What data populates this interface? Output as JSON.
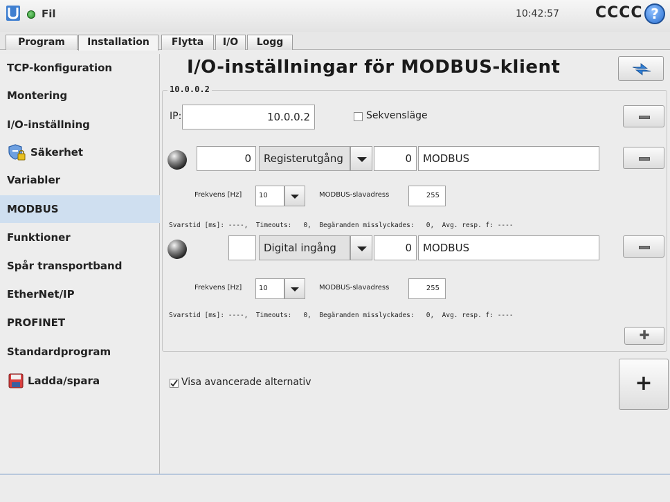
{
  "header": {
    "file_label": "Fil",
    "clock": "10:42:57",
    "robot_name": "CCCC",
    "help_icon": "?"
  },
  "tabs": [
    {
      "label": "Program",
      "active": false
    },
    {
      "label": "Installation",
      "active": true
    },
    {
      "label": "Flytta",
      "active": false
    },
    {
      "label": "I/O",
      "active": false
    },
    {
      "label": "Logg",
      "active": false
    }
  ],
  "sidebar": {
    "items": [
      {
        "label": "TCP-konfiguration"
      },
      {
        "label": "Montering"
      },
      {
        "label": "I/O-inställning"
      },
      {
        "label": "Säkerhet",
        "icon": "shield-lock-icon"
      },
      {
        "label": "Variabler"
      },
      {
        "label": "MODBUS",
        "active": true
      },
      {
        "label": "Funktioner"
      },
      {
        "label": "Spår transportband"
      },
      {
        "label": "EtherNet/IP"
      },
      {
        "label": "PROFINET"
      },
      {
        "label": "Standardprogram"
      },
      {
        "label": "Ladda/spara",
        "icon": "floppy-disk-icon"
      }
    ]
  },
  "main": {
    "title": "I/O-inställningar för MODBUS-klient",
    "group_label": "10.0.0.2",
    "ip_label": "IP:",
    "ip_value": "10.0.0.2",
    "sequence_label": "Sekvensläge",
    "signals": [
      {
        "address": "0",
        "type": "Registerutgång",
        "register": "0",
        "name": "MODBUS",
        "freq_label": "Frekvens [Hz]",
        "freq_value": "10",
        "slave_label": "MODBUS-slavadress",
        "slave_value": "255",
        "status_text": "Svarstid [ms]: ----,  Timeouts:   0,  Begäranden misslyckades:   0,  Avg. resp. f: ----"
      },
      {
        "address": "",
        "type": "Digital ingång",
        "register": "0",
        "name": "MODBUS",
        "freq_label": "Frekvens [Hz]",
        "freq_value": "10",
        "slave_label": "MODBUS-slavadress",
        "slave_value": "255",
        "status_text": "Svarstid [ms]: ----,  Timeouts:   0,  Begäranden misslyckades:   0,  Avg. resp. f: ----"
      }
    ],
    "advanced_label": "Visa avancerade alternativ",
    "advanced_checked": true,
    "add_signal_symbol": "✚",
    "add_unit_symbol": "+"
  }
}
